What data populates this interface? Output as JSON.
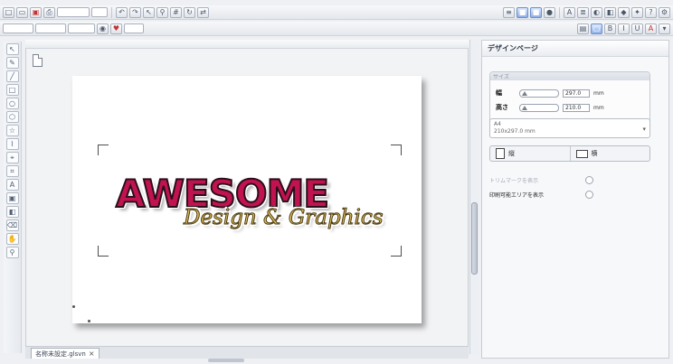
{
  "colors": {
    "logo_main": "#c0134f",
    "logo_sub": "#e2c060",
    "panel_bg": "#f7f8fa"
  },
  "toolbar": {
    "icons": [
      "new-icon",
      "open-icon",
      "save-icon",
      "print-icon",
      "undo-icon",
      "redo-icon",
      "select-icon",
      "zoom-icon",
      "grid-icon",
      "layers-icon",
      "text-icon",
      "align-icon",
      "color-icon",
      "help-icon"
    ]
  },
  "canvas": {
    "logo": {
      "main_text": "AWESOME",
      "sub_text": "Design & Graphics"
    },
    "doc_tab": {
      "label": "名称未設定.glsvn",
      "close": "×"
    }
  },
  "panel": {
    "title": "デザインページ",
    "group_label": "サイズ",
    "width_label": "幅",
    "width_value": "297.0",
    "width_unit": "mm",
    "height_label": "高さ",
    "height_value": "210.0",
    "height_unit": "mm",
    "preset_line1": "A4",
    "preset_line2": "210x297.0 mm",
    "portrait_label": "縦",
    "landscape_label": "横",
    "check1_label": "トリムマークを表示",
    "check2_label": "印刷可能エリアを表示"
  }
}
